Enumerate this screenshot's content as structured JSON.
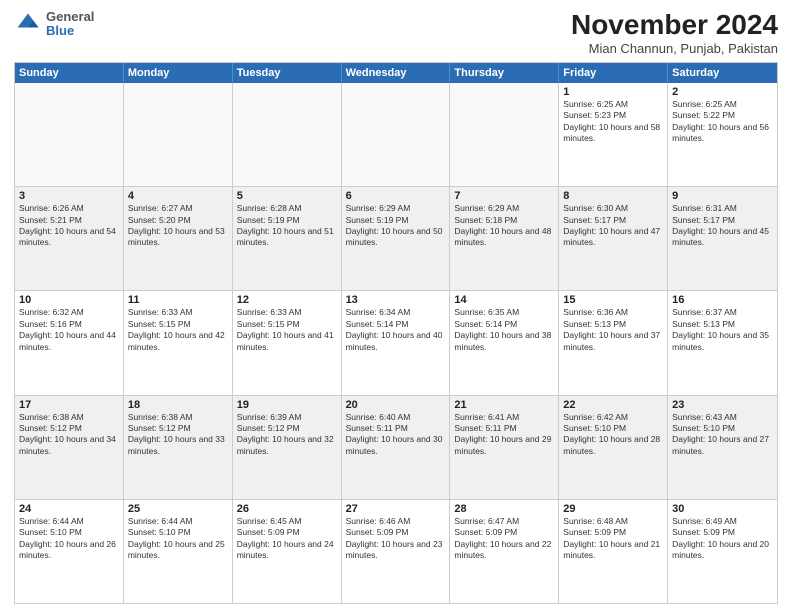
{
  "header": {
    "logo": {
      "general": "General",
      "blue": "Blue"
    },
    "title": "November 2024",
    "location": "Mian Channun, Punjab, Pakistan"
  },
  "weekdays": [
    "Sunday",
    "Monday",
    "Tuesday",
    "Wednesday",
    "Thursday",
    "Friday",
    "Saturday"
  ],
  "rows": [
    [
      {
        "day": "",
        "info": ""
      },
      {
        "day": "",
        "info": ""
      },
      {
        "day": "",
        "info": ""
      },
      {
        "day": "",
        "info": ""
      },
      {
        "day": "",
        "info": ""
      },
      {
        "day": "1",
        "info": "Sunrise: 6:25 AM\nSunset: 5:23 PM\nDaylight: 10 hours and 58 minutes."
      },
      {
        "day": "2",
        "info": "Sunrise: 6:25 AM\nSunset: 5:22 PM\nDaylight: 10 hours and 56 minutes."
      }
    ],
    [
      {
        "day": "3",
        "info": "Sunrise: 6:26 AM\nSunset: 5:21 PM\nDaylight: 10 hours and 54 minutes."
      },
      {
        "day": "4",
        "info": "Sunrise: 6:27 AM\nSunset: 5:20 PM\nDaylight: 10 hours and 53 minutes."
      },
      {
        "day": "5",
        "info": "Sunrise: 6:28 AM\nSunset: 5:19 PM\nDaylight: 10 hours and 51 minutes."
      },
      {
        "day": "6",
        "info": "Sunrise: 6:29 AM\nSunset: 5:19 PM\nDaylight: 10 hours and 50 minutes."
      },
      {
        "day": "7",
        "info": "Sunrise: 6:29 AM\nSunset: 5:18 PM\nDaylight: 10 hours and 48 minutes."
      },
      {
        "day": "8",
        "info": "Sunrise: 6:30 AM\nSunset: 5:17 PM\nDaylight: 10 hours and 47 minutes."
      },
      {
        "day": "9",
        "info": "Sunrise: 6:31 AM\nSunset: 5:17 PM\nDaylight: 10 hours and 45 minutes."
      }
    ],
    [
      {
        "day": "10",
        "info": "Sunrise: 6:32 AM\nSunset: 5:16 PM\nDaylight: 10 hours and 44 minutes."
      },
      {
        "day": "11",
        "info": "Sunrise: 6:33 AM\nSunset: 5:15 PM\nDaylight: 10 hours and 42 minutes."
      },
      {
        "day": "12",
        "info": "Sunrise: 6:33 AM\nSunset: 5:15 PM\nDaylight: 10 hours and 41 minutes."
      },
      {
        "day": "13",
        "info": "Sunrise: 6:34 AM\nSunset: 5:14 PM\nDaylight: 10 hours and 40 minutes."
      },
      {
        "day": "14",
        "info": "Sunrise: 6:35 AM\nSunset: 5:14 PM\nDaylight: 10 hours and 38 minutes."
      },
      {
        "day": "15",
        "info": "Sunrise: 6:36 AM\nSunset: 5:13 PM\nDaylight: 10 hours and 37 minutes."
      },
      {
        "day": "16",
        "info": "Sunrise: 6:37 AM\nSunset: 5:13 PM\nDaylight: 10 hours and 35 minutes."
      }
    ],
    [
      {
        "day": "17",
        "info": "Sunrise: 6:38 AM\nSunset: 5:12 PM\nDaylight: 10 hours and 34 minutes."
      },
      {
        "day": "18",
        "info": "Sunrise: 6:38 AM\nSunset: 5:12 PM\nDaylight: 10 hours and 33 minutes."
      },
      {
        "day": "19",
        "info": "Sunrise: 6:39 AM\nSunset: 5:12 PM\nDaylight: 10 hours and 32 minutes."
      },
      {
        "day": "20",
        "info": "Sunrise: 6:40 AM\nSunset: 5:11 PM\nDaylight: 10 hours and 30 minutes."
      },
      {
        "day": "21",
        "info": "Sunrise: 6:41 AM\nSunset: 5:11 PM\nDaylight: 10 hours and 29 minutes."
      },
      {
        "day": "22",
        "info": "Sunrise: 6:42 AM\nSunset: 5:10 PM\nDaylight: 10 hours and 28 minutes."
      },
      {
        "day": "23",
        "info": "Sunrise: 6:43 AM\nSunset: 5:10 PM\nDaylight: 10 hours and 27 minutes."
      }
    ],
    [
      {
        "day": "24",
        "info": "Sunrise: 6:44 AM\nSunset: 5:10 PM\nDaylight: 10 hours and 26 minutes."
      },
      {
        "day": "25",
        "info": "Sunrise: 6:44 AM\nSunset: 5:10 PM\nDaylight: 10 hours and 25 minutes."
      },
      {
        "day": "26",
        "info": "Sunrise: 6:45 AM\nSunset: 5:09 PM\nDaylight: 10 hours and 24 minutes."
      },
      {
        "day": "27",
        "info": "Sunrise: 6:46 AM\nSunset: 5:09 PM\nDaylight: 10 hours and 23 minutes."
      },
      {
        "day": "28",
        "info": "Sunrise: 6:47 AM\nSunset: 5:09 PM\nDaylight: 10 hours and 22 minutes."
      },
      {
        "day": "29",
        "info": "Sunrise: 6:48 AM\nSunset: 5:09 PM\nDaylight: 10 hours and 21 minutes."
      },
      {
        "day": "30",
        "info": "Sunrise: 6:49 AM\nSunset: 5:09 PM\nDaylight: 10 hours and 20 minutes."
      }
    ]
  ]
}
